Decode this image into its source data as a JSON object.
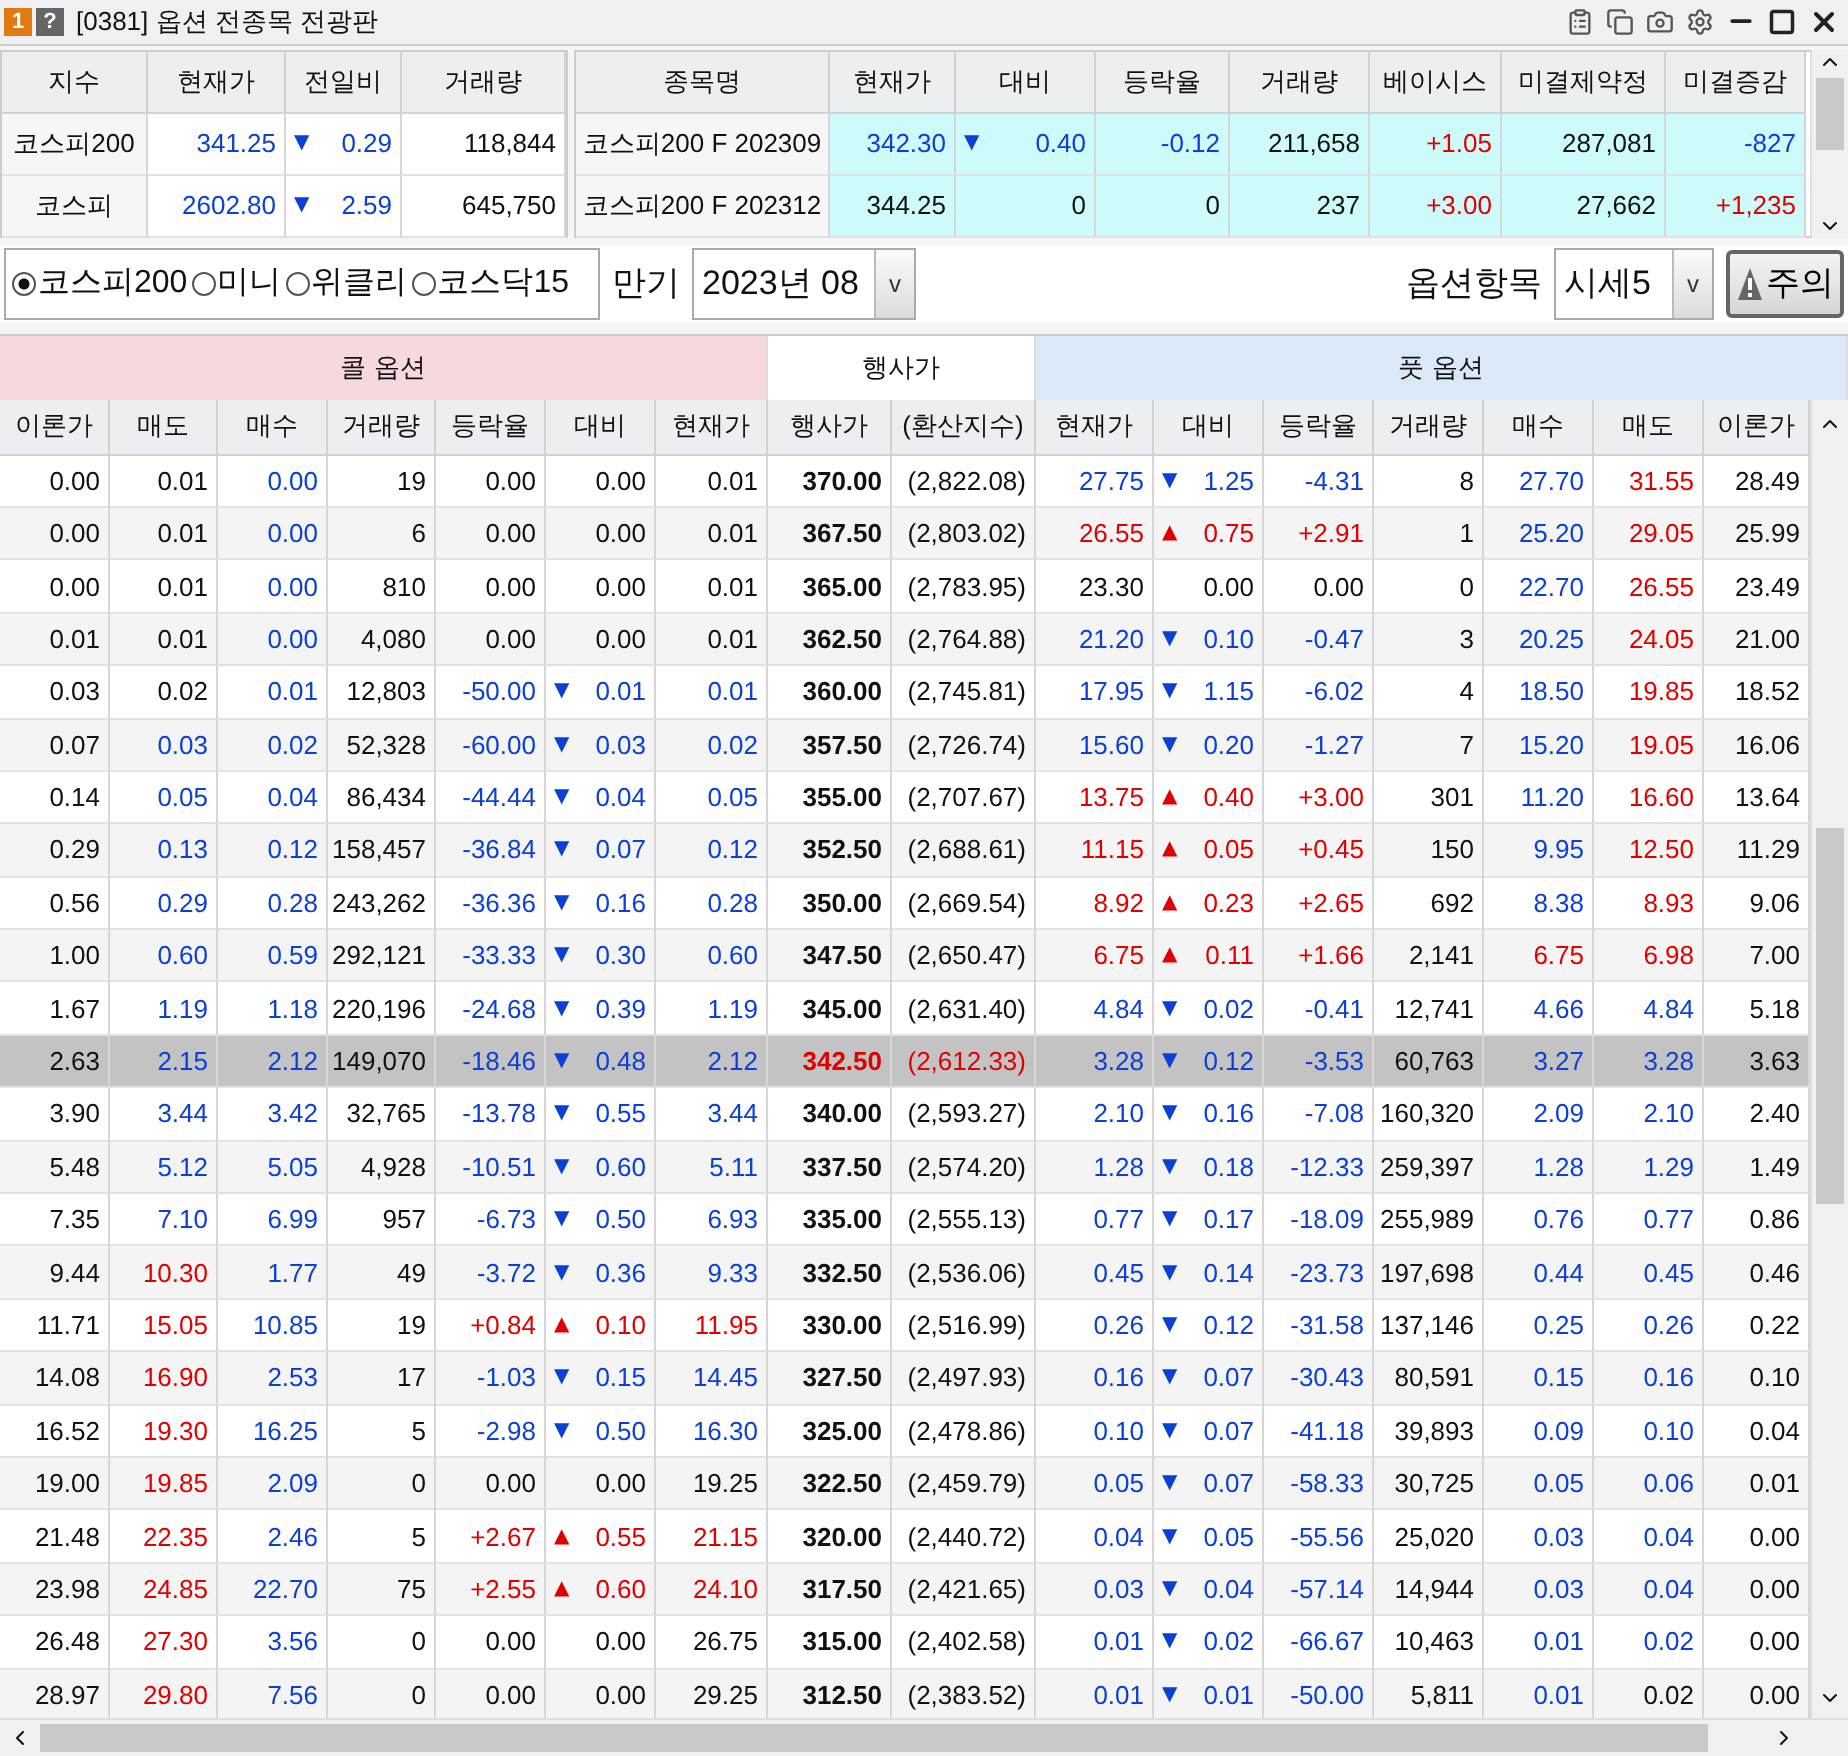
{
  "window": {
    "badges": [
      "1",
      "?"
    ],
    "title": "[0381] 옵션 전종목 전광판"
  },
  "index_table": {
    "columns": [
      "지수",
      "현재가",
      "전일비",
      "거래량"
    ],
    "rows": [
      {
        "cells": [
          {
            "text": "코스피200",
            "color": "#111111"
          },
          {
            "text": "341.25",
            "color": "#0b3fd6"
          },
          {
            "text": "0.29",
            "color": "#0b3fd6",
            "sign": "▼"
          },
          {
            "text": "118,844",
            "color": "#111111"
          }
        ]
      },
      {
        "cells": [
          {
            "text": "코스피",
            "color": "#111111"
          },
          {
            "text": "2602.80",
            "color": "#0b3fd6"
          },
          {
            "text": "2.59",
            "color": "#0b3fd6",
            "sign": "▼"
          },
          {
            "text": "645,750",
            "color": "#111111"
          }
        ]
      }
    ]
  },
  "futures_table": {
    "columns": [
      "종목명",
      "현재가",
      "대비",
      "등락율",
      "거래량",
      "베이시스",
      "미결제약정",
      "미결증감"
    ],
    "rows": [
      {
        "cells": [
          {
            "text": "코스피200 F 202309",
            "color": "#111111"
          },
          {
            "text": "342.30",
            "color": "#0b3fd6"
          },
          {
            "text": "0.40",
            "color": "#0b3fd6",
            "sign": "▼"
          },
          {
            "text": "-0.12",
            "color": "#0b3fd6"
          },
          {
            "text": "211,658",
            "color": "#111111"
          },
          {
            "text": "+1.05",
            "color": "#e00000"
          },
          {
            "text": "287,081",
            "color": "#111111"
          },
          {
            "text": "-827",
            "color": "#0b3fd6"
          }
        ]
      },
      {
        "cells": [
          {
            "text": "코스피200 F 202312",
            "color": "#111111"
          },
          {
            "text": "344.25",
            "color": "#111111"
          },
          {
            "text": "0",
            "color": "#111111"
          },
          {
            "text": "0",
            "color": "#111111"
          },
          {
            "text": "237",
            "color": "#111111"
          },
          {
            "text": "+3.00",
            "color": "#e00000"
          },
          {
            "text": "27,662",
            "color": "#111111"
          },
          {
            "text": "+1,235",
            "color": "#e00000"
          }
        ]
      }
    ]
  },
  "market_options": [
    {
      "label": "코스피200",
      "selected": true
    },
    {
      "label": "미니",
      "selected": false
    },
    {
      "label": "위클리",
      "selected": false
    },
    {
      "label": "코스닥15",
      "selected": false
    }
  ],
  "expiry": {
    "label": "만기",
    "value": "2023년 08",
    "button": "v"
  },
  "option_items": {
    "label": "옵션항목",
    "value": "시세5",
    "button": "v"
  },
  "warning_button": "주의",
  "board": {
    "call_title": "콜 옵션",
    "strike_title": "행사가",
    "put_title": "풋 옵션",
    "columns": [
      "이론가",
      "매도",
      "매수",
      "거래량",
      "등락율",
      "대비",
      "현재가",
      "행사가",
      "(환산지수)",
      "현재가",
      "대비",
      "등락율",
      "거래량",
      "매수",
      "매도",
      "이론가"
    ],
    "rows": [
      {
        "selected": false,
        "call": [
          {
            "text": "0.00",
            "color": "#111111"
          },
          {
            "text": "0.01",
            "color": "#111111"
          },
          {
            "text": "0.00",
            "color": "#0b3fd6"
          },
          {
            "text": "19",
            "color": "#111111"
          },
          {
            "text": "0.00",
            "color": "#111111"
          },
          {
            "text": "0.00",
            "color": "#111111"
          },
          {
            "text": "0.01",
            "color": "#111111"
          }
        ],
        "strike": {
          "text": "370.00",
          "color": "#111111"
        },
        "index": {
          "text": "(2,822.08)",
          "color": "#111111"
        },
        "put": [
          {
            "text": "27.75",
            "color": "#0b3fd6"
          },
          {
            "text": "1.25",
            "color": "#0b3fd6",
            "sign": "▼"
          },
          {
            "text": "-4.31",
            "color": "#0b3fd6"
          },
          {
            "text": "8",
            "color": "#111111"
          },
          {
            "text": "27.70",
            "color": "#0b3fd6"
          },
          {
            "text": "31.55",
            "color": "#e00000"
          },
          {
            "text": "28.49",
            "color": "#111111"
          }
        ]
      },
      {
        "selected": false,
        "call": [
          {
            "text": "0.00",
            "color": "#111111"
          },
          {
            "text": "0.01",
            "color": "#111111"
          },
          {
            "text": "0.00",
            "color": "#0b3fd6"
          },
          {
            "text": "6",
            "color": "#111111"
          },
          {
            "text": "0.00",
            "color": "#111111"
          },
          {
            "text": "0.00",
            "color": "#111111"
          },
          {
            "text": "0.01",
            "color": "#111111"
          }
        ],
        "strike": {
          "text": "367.50",
          "color": "#111111"
        },
        "index": {
          "text": "(2,803.02)",
          "color": "#111111"
        },
        "put": [
          {
            "text": "26.55",
            "color": "#e00000"
          },
          {
            "text": "0.75",
            "color": "#e00000",
            "sign": "▲"
          },
          {
            "text": "+2.91",
            "color": "#e00000"
          },
          {
            "text": "1",
            "color": "#111111"
          },
          {
            "text": "25.20",
            "color": "#0b3fd6"
          },
          {
            "text": "29.05",
            "color": "#e00000"
          },
          {
            "text": "25.99",
            "color": "#111111"
          }
        ]
      },
      {
        "selected": false,
        "call": [
          {
            "text": "0.00",
            "color": "#111111"
          },
          {
            "text": "0.01",
            "color": "#111111"
          },
          {
            "text": "0.00",
            "color": "#0b3fd6"
          },
          {
            "text": "810",
            "color": "#111111"
          },
          {
            "text": "0.00",
            "color": "#111111"
          },
          {
            "text": "0.00",
            "color": "#111111"
          },
          {
            "text": "0.01",
            "color": "#111111"
          }
        ],
        "strike": {
          "text": "365.00",
          "color": "#111111"
        },
        "index": {
          "text": "(2,783.95)",
          "color": "#111111"
        },
        "put": [
          {
            "text": "23.30",
            "color": "#111111"
          },
          {
            "text": "0.00",
            "color": "#111111"
          },
          {
            "text": "0.00",
            "color": "#111111"
          },
          {
            "text": "0",
            "color": "#111111"
          },
          {
            "text": "22.70",
            "color": "#0b3fd6"
          },
          {
            "text": "26.55",
            "color": "#e00000"
          },
          {
            "text": "23.49",
            "color": "#111111"
          }
        ]
      },
      {
        "selected": false,
        "call": [
          {
            "text": "0.01",
            "color": "#111111"
          },
          {
            "text": "0.01",
            "color": "#111111"
          },
          {
            "text": "0.00",
            "color": "#0b3fd6"
          },
          {
            "text": "4,080",
            "color": "#111111"
          },
          {
            "text": "0.00",
            "color": "#111111"
          },
          {
            "text": "0.00",
            "color": "#111111"
          },
          {
            "text": "0.01",
            "color": "#111111"
          }
        ],
        "strike": {
          "text": "362.50",
          "color": "#111111"
        },
        "index": {
          "text": "(2,764.88)",
          "color": "#111111"
        },
        "put": [
          {
            "text": "21.20",
            "color": "#0b3fd6"
          },
          {
            "text": "0.10",
            "color": "#0b3fd6",
            "sign": "▼"
          },
          {
            "text": "-0.47",
            "color": "#0b3fd6"
          },
          {
            "text": "3",
            "color": "#111111"
          },
          {
            "text": "20.25",
            "color": "#0b3fd6"
          },
          {
            "text": "24.05",
            "color": "#e00000"
          },
          {
            "text": "21.00",
            "color": "#111111"
          }
        ]
      },
      {
        "selected": false,
        "call": [
          {
            "text": "0.03",
            "color": "#111111"
          },
          {
            "text": "0.02",
            "color": "#111111"
          },
          {
            "text": "0.01",
            "color": "#0b3fd6"
          },
          {
            "text": "12,803",
            "color": "#111111"
          },
          {
            "text": "-50.00",
            "color": "#0b3fd6"
          },
          {
            "text": "0.01",
            "color": "#0b3fd6",
            "sign": "▼"
          },
          {
            "text": "0.01",
            "color": "#0b3fd6"
          }
        ],
        "strike": {
          "text": "360.00",
          "color": "#111111"
        },
        "index": {
          "text": "(2,745.81)",
          "color": "#111111"
        },
        "put": [
          {
            "text": "17.95",
            "color": "#0b3fd6"
          },
          {
            "text": "1.15",
            "color": "#0b3fd6",
            "sign": "▼"
          },
          {
            "text": "-6.02",
            "color": "#0b3fd6"
          },
          {
            "text": "4",
            "color": "#111111"
          },
          {
            "text": "18.50",
            "color": "#0b3fd6"
          },
          {
            "text": "19.85",
            "color": "#e00000"
          },
          {
            "text": "18.52",
            "color": "#111111"
          }
        ]
      },
      {
        "selected": false,
        "call": [
          {
            "text": "0.07",
            "color": "#111111"
          },
          {
            "text": "0.03",
            "color": "#0b3fd6"
          },
          {
            "text": "0.02",
            "color": "#0b3fd6"
          },
          {
            "text": "52,328",
            "color": "#111111"
          },
          {
            "text": "-60.00",
            "color": "#0b3fd6"
          },
          {
            "text": "0.03",
            "color": "#0b3fd6",
            "sign": "▼"
          },
          {
            "text": "0.02",
            "color": "#0b3fd6"
          }
        ],
        "strike": {
          "text": "357.50",
          "color": "#111111"
        },
        "index": {
          "text": "(2,726.74)",
          "color": "#111111"
        },
        "put": [
          {
            "text": "15.60",
            "color": "#0b3fd6"
          },
          {
            "text": "0.20",
            "color": "#0b3fd6",
            "sign": "▼"
          },
          {
            "text": "-1.27",
            "color": "#0b3fd6"
          },
          {
            "text": "7",
            "color": "#111111"
          },
          {
            "text": "15.20",
            "color": "#0b3fd6"
          },
          {
            "text": "19.05",
            "color": "#e00000"
          },
          {
            "text": "16.06",
            "color": "#111111"
          }
        ]
      },
      {
        "selected": false,
        "call": [
          {
            "text": "0.14",
            "color": "#111111"
          },
          {
            "text": "0.05",
            "color": "#0b3fd6"
          },
          {
            "text": "0.04",
            "color": "#0b3fd6"
          },
          {
            "text": "86,434",
            "color": "#111111"
          },
          {
            "text": "-44.44",
            "color": "#0b3fd6"
          },
          {
            "text": "0.04",
            "color": "#0b3fd6",
            "sign": "▼"
          },
          {
            "text": "0.05",
            "color": "#0b3fd6"
          }
        ],
        "strike": {
          "text": "355.00",
          "color": "#111111"
        },
        "index": {
          "text": "(2,707.67)",
          "color": "#111111"
        },
        "put": [
          {
            "text": "13.75",
            "color": "#e00000"
          },
          {
            "text": "0.40",
            "color": "#e00000",
            "sign": "▲"
          },
          {
            "text": "+3.00",
            "color": "#e00000"
          },
          {
            "text": "301",
            "color": "#111111"
          },
          {
            "text": "11.20",
            "color": "#0b3fd6"
          },
          {
            "text": "16.60",
            "color": "#e00000"
          },
          {
            "text": "13.64",
            "color": "#111111"
          }
        ]
      },
      {
        "selected": false,
        "call": [
          {
            "text": "0.29",
            "color": "#111111"
          },
          {
            "text": "0.13",
            "color": "#0b3fd6"
          },
          {
            "text": "0.12",
            "color": "#0b3fd6"
          },
          {
            "text": "158,457",
            "color": "#111111"
          },
          {
            "text": "-36.84",
            "color": "#0b3fd6"
          },
          {
            "text": "0.07",
            "color": "#0b3fd6",
            "sign": "▼"
          },
          {
            "text": "0.12",
            "color": "#0b3fd6"
          }
        ],
        "strike": {
          "text": "352.50",
          "color": "#111111"
        },
        "index": {
          "text": "(2,688.61)",
          "color": "#111111"
        },
        "put": [
          {
            "text": "11.15",
            "color": "#e00000"
          },
          {
            "text": "0.05",
            "color": "#e00000",
            "sign": "▲"
          },
          {
            "text": "+0.45",
            "color": "#e00000"
          },
          {
            "text": "150",
            "color": "#111111"
          },
          {
            "text": "9.95",
            "color": "#0b3fd6"
          },
          {
            "text": "12.50",
            "color": "#e00000"
          },
          {
            "text": "11.29",
            "color": "#111111"
          }
        ]
      },
      {
        "selected": false,
        "call": [
          {
            "text": "0.56",
            "color": "#111111"
          },
          {
            "text": "0.29",
            "color": "#0b3fd6"
          },
          {
            "text": "0.28",
            "color": "#0b3fd6"
          },
          {
            "text": "243,262",
            "color": "#111111"
          },
          {
            "text": "-36.36",
            "color": "#0b3fd6"
          },
          {
            "text": "0.16",
            "color": "#0b3fd6",
            "sign": "▼"
          },
          {
            "text": "0.28",
            "color": "#0b3fd6"
          }
        ],
        "strike": {
          "text": "350.00",
          "color": "#111111"
        },
        "index": {
          "text": "(2,669.54)",
          "color": "#111111"
        },
        "put": [
          {
            "text": "8.92",
            "color": "#e00000"
          },
          {
            "text": "0.23",
            "color": "#e00000",
            "sign": "▲"
          },
          {
            "text": "+2.65",
            "color": "#e00000"
          },
          {
            "text": "692",
            "color": "#111111"
          },
          {
            "text": "8.38",
            "color": "#0b3fd6"
          },
          {
            "text": "8.93",
            "color": "#e00000"
          },
          {
            "text": "9.06",
            "color": "#111111"
          }
        ]
      },
      {
        "selected": false,
        "call": [
          {
            "text": "1.00",
            "color": "#111111"
          },
          {
            "text": "0.60",
            "color": "#0b3fd6"
          },
          {
            "text": "0.59",
            "color": "#0b3fd6"
          },
          {
            "text": "292,121",
            "color": "#111111"
          },
          {
            "text": "-33.33",
            "color": "#0b3fd6"
          },
          {
            "text": "0.30",
            "color": "#0b3fd6",
            "sign": "▼"
          },
          {
            "text": "0.60",
            "color": "#0b3fd6"
          }
        ],
        "strike": {
          "text": "347.50",
          "color": "#111111"
        },
        "index": {
          "text": "(2,650.47)",
          "color": "#111111"
        },
        "put": [
          {
            "text": "6.75",
            "color": "#e00000"
          },
          {
            "text": "0.11",
            "color": "#e00000",
            "sign": "▲"
          },
          {
            "text": "+1.66",
            "color": "#e00000"
          },
          {
            "text": "2,141",
            "color": "#111111"
          },
          {
            "text": "6.75",
            "color": "#e00000"
          },
          {
            "text": "6.98",
            "color": "#e00000"
          },
          {
            "text": "7.00",
            "color": "#111111"
          }
        ]
      },
      {
        "selected": false,
        "call": [
          {
            "text": "1.67",
            "color": "#111111"
          },
          {
            "text": "1.19",
            "color": "#0b3fd6"
          },
          {
            "text": "1.18",
            "color": "#0b3fd6"
          },
          {
            "text": "220,196",
            "color": "#111111"
          },
          {
            "text": "-24.68",
            "color": "#0b3fd6"
          },
          {
            "text": "0.39",
            "color": "#0b3fd6",
            "sign": "▼"
          },
          {
            "text": "1.19",
            "color": "#0b3fd6"
          }
        ],
        "strike": {
          "text": "345.00",
          "color": "#111111"
        },
        "index": {
          "text": "(2,631.40)",
          "color": "#111111"
        },
        "put": [
          {
            "text": "4.84",
            "color": "#0b3fd6"
          },
          {
            "text": "0.02",
            "color": "#0b3fd6",
            "sign": "▼"
          },
          {
            "text": "-0.41",
            "color": "#0b3fd6"
          },
          {
            "text": "12,741",
            "color": "#111111"
          },
          {
            "text": "4.66",
            "color": "#0b3fd6"
          },
          {
            "text": "4.84",
            "color": "#0b3fd6"
          },
          {
            "text": "5.18",
            "color": "#111111"
          }
        ]
      },
      {
        "selected": true,
        "call": [
          {
            "text": "2.63",
            "color": "#111111"
          },
          {
            "text": "2.15",
            "color": "#0b3fd6"
          },
          {
            "text": "2.12",
            "color": "#0b3fd6"
          },
          {
            "text": "149,070",
            "color": "#111111"
          },
          {
            "text": "-18.46",
            "color": "#0b3fd6"
          },
          {
            "text": "0.48",
            "color": "#0b3fd6",
            "sign": "▼"
          },
          {
            "text": "2.12",
            "color": "#0b3fd6"
          }
        ],
        "strike": {
          "text": "342.50",
          "color": "#e00000"
        },
        "index": {
          "text": "(2,612.33)",
          "color": "#e00000"
        },
        "put": [
          {
            "text": "3.28",
            "color": "#0b3fd6"
          },
          {
            "text": "0.12",
            "color": "#0b3fd6",
            "sign": "▼"
          },
          {
            "text": "-3.53",
            "color": "#0b3fd6"
          },
          {
            "text": "60,763",
            "color": "#111111"
          },
          {
            "text": "3.27",
            "color": "#0b3fd6"
          },
          {
            "text": "3.28",
            "color": "#0b3fd6"
          },
          {
            "text": "3.63",
            "color": "#111111"
          }
        ]
      },
      {
        "selected": false,
        "call": [
          {
            "text": "3.90",
            "color": "#111111"
          },
          {
            "text": "3.44",
            "color": "#0b3fd6"
          },
          {
            "text": "3.42",
            "color": "#0b3fd6"
          },
          {
            "text": "32,765",
            "color": "#111111"
          },
          {
            "text": "-13.78",
            "color": "#0b3fd6"
          },
          {
            "text": "0.55",
            "color": "#0b3fd6",
            "sign": "▼"
          },
          {
            "text": "3.44",
            "color": "#0b3fd6"
          }
        ],
        "strike": {
          "text": "340.00",
          "color": "#111111"
        },
        "index": {
          "text": "(2,593.27)",
          "color": "#111111"
        },
        "put": [
          {
            "text": "2.10",
            "color": "#0b3fd6"
          },
          {
            "text": "0.16",
            "color": "#0b3fd6",
            "sign": "▼"
          },
          {
            "text": "-7.08",
            "color": "#0b3fd6"
          },
          {
            "text": "160,320",
            "color": "#111111"
          },
          {
            "text": "2.09",
            "color": "#0b3fd6"
          },
          {
            "text": "2.10",
            "color": "#0b3fd6"
          },
          {
            "text": "2.40",
            "color": "#111111"
          }
        ]
      },
      {
        "selected": false,
        "call": [
          {
            "text": "5.48",
            "color": "#111111"
          },
          {
            "text": "5.12",
            "color": "#0b3fd6"
          },
          {
            "text": "5.05",
            "color": "#0b3fd6"
          },
          {
            "text": "4,928",
            "color": "#111111"
          },
          {
            "text": "-10.51",
            "color": "#0b3fd6"
          },
          {
            "text": "0.60",
            "color": "#0b3fd6",
            "sign": "▼"
          },
          {
            "text": "5.11",
            "color": "#0b3fd6"
          }
        ],
        "strike": {
          "text": "337.50",
          "color": "#111111"
        },
        "index": {
          "text": "(2,574.20)",
          "color": "#111111"
        },
        "put": [
          {
            "text": "1.28",
            "color": "#0b3fd6"
          },
          {
            "text": "0.18",
            "color": "#0b3fd6",
            "sign": "▼"
          },
          {
            "text": "-12.33",
            "color": "#0b3fd6"
          },
          {
            "text": "259,397",
            "color": "#111111"
          },
          {
            "text": "1.28",
            "color": "#0b3fd6"
          },
          {
            "text": "1.29",
            "color": "#0b3fd6"
          },
          {
            "text": "1.49",
            "color": "#111111"
          }
        ]
      },
      {
        "selected": false,
        "call": [
          {
            "text": "7.35",
            "color": "#111111"
          },
          {
            "text": "7.10",
            "color": "#0b3fd6"
          },
          {
            "text": "6.99",
            "color": "#0b3fd6"
          },
          {
            "text": "957",
            "color": "#111111"
          },
          {
            "text": "-6.73",
            "color": "#0b3fd6"
          },
          {
            "text": "0.50",
            "color": "#0b3fd6",
            "sign": "▼"
          },
          {
            "text": "6.93",
            "color": "#0b3fd6"
          }
        ],
        "strike": {
          "text": "335.00",
          "color": "#111111"
        },
        "index": {
          "text": "(2,555.13)",
          "color": "#111111"
        },
        "put": [
          {
            "text": "0.77",
            "color": "#0b3fd6"
          },
          {
            "text": "0.17",
            "color": "#0b3fd6",
            "sign": "▼"
          },
          {
            "text": "-18.09",
            "color": "#0b3fd6"
          },
          {
            "text": "255,989",
            "color": "#111111"
          },
          {
            "text": "0.76",
            "color": "#0b3fd6"
          },
          {
            "text": "0.77",
            "color": "#0b3fd6"
          },
          {
            "text": "0.86",
            "color": "#111111"
          }
        ]
      },
      {
        "selected": false,
        "call": [
          {
            "text": "9.44",
            "color": "#111111"
          },
          {
            "text": "10.30",
            "color": "#e00000"
          },
          {
            "text": "1.77",
            "color": "#0b3fd6"
          },
          {
            "text": "49",
            "color": "#111111"
          },
          {
            "text": "-3.72",
            "color": "#0b3fd6"
          },
          {
            "text": "0.36",
            "color": "#0b3fd6",
            "sign": "▼"
          },
          {
            "text": "9.33",
            "color": "#0b3fd6"
          }
        ],
        "strike": {
          "text": "332.50",
          "color": "#111111"
        },
        "index": {
          "text": "(2,536.06)",
          "color": "#111111"
        },
        "put": [
          {
            "text": "0.45",
            "color": "#0b3fd6"
          },
          {
            "text": "0.14",
            "color": "#0b3fd6",
            "sign": "▼"
          },
          {
            "text": "-23.73",
            "color": "#0b3fd6"
          },
          {
            "text": "197,698",
            "color": "#111111"
          },
          {
            "text": "0.44",
            "color": "#0b3fd6"
          },
          {
            "text": "0.45",
            "color": "#0b3fd6"
          },
          {
            "text": "0.46",
            "color": "#111111"
          }
        ]
      },
      {
        "selected": false,
        "call": [
          {
            "text": "11.71",
            "color": "#111111"
          },
          {
            "text": "15.05",
            "color": "#e00000"
          },
          {
            "text": "10.85",
            "color": "#0b3fd6"
          },
          {
            "text": "19",
            "color": "#111111"
          },
          {
            "text": "+0.84",
            "color": "#e00000"
          },
          {
            "text": "0.10",
            "color": "#e00000",
            "sign": "▲"
          },
          {
            "text": "11.95",
            "color": "#e00000"
          }
        ],
        "strike": {
          "text": "330.00",
          "color": "#111111"
        },
        "index": {
          "text": "(2,516.99)",
          "color": "#111111"
        },
        "put": [
          {
            "text": "0.26",
            "color": "#0b3fd6"
          },
          {
            "text": "0.12",
            "color": "#0b3fd6",
            "sign": "▼"
          },
          {
            "text": "-31.58",
            "color": "#0b3fd6"
          },
          {
            "text": "137,146",
            "color": "#111111"
          },
          {
            "text": "0.25",
            "color": "#0b3fd6"
          },
          {
            "text": "0.26",
            "color": "#0b3fd6"
          },
          {
            "text": "0.22",
            "color": "#111111"
          }
        ]
      },
      {
        "selected": false,
        "call": [
          {
            "text": "14.08",
            "color": "#111111"
          },
          {
            "text": "16.90",
            "color": "#e00000"
          },
          {
            "text": "2.53",
            "color": "#0b3fd6"
          },
          {
            "text": "17",
            "color": "#111111"
          },
          {
            "text": "-1.03",
            "color": "#0b3fd6"
          },
          {
            "text": "0.15",
            "color": "#0b3fd6",
            "sign": "▼"
          },
          {
            "text": "14.45",
            "color": "#0b3fd6"
          }
        ],
        "strike": {
          "text": "327.50",
          "color": "#111111"
        },
        "index": {
          "text": "(2,497.93)",
          "color": "#111111"
        },
        "put": [
          {
            "text": "0.16",
            "color": "#0b3fd6"
          },
          {
            "text": "0.07",
            "color": "#0b3fd6",
            "sign": "▼"
          },
          {
            "text": "-30.43",
            "color": "#0b3fd6"
          },
          {
            "text": "80,591",
            "color": "#111111"
          },
          {
            "text": "0.15",
            "color": "#0b3fd6"
          },
          {
            "text": "0.16",
            "color": "#0b3fd6"
          },
          {
            "text": "0.10",
            "color": "#111111"
          }
        ]
      },
      {
        "selected": false,
        "call": [
          {
            "text": "16.52",
            "color": "#111111"
          },
          {
            "text": "19.30",
            "color": "#e00000"
          },
          {
            "text": "16.25",
            "color": "#0b3fd6"
          },
          {
            "text": "5",
            "color": "#111111"
          },
          {
            "text": "-2.98",
            "color": "#0b3fd6"
          },
          {
            "text": "0.50",
            "color": "#0b3fd6",
            "sign": "▼"
          },
          {
            "text": "16.30",
            "color": "#0b3fd6"
          }
        ],
        "strike": {
          "text": "325.00",
          "color": "#111111"
        },
        "index": {
          "text": "(2,478.86)",
          "color": "#111111"
        },
        "put": [
          {
            "text": "0.10",
            "color": "#0b3fd6"
          },
          {
            "text": "0.07",
            "color": "#0b3fd6",
            "sign": "▼"
          },
          {
            "text": "-41.18",
            "color": "#0b3fd6"
          },
          {
            "text": "39,893",
            "color": "#111111"
          },
          {
            "text": "0.09",
            "color": "#0b3fd6"
          },
          {
            "text": "0.10",
            "color": "#0b3fd6"
          },
          {
            "text": "0.04",
            "color": "#111111"
          }
        ]
      },
      {
        "selected": false,
        "call": [
          {
            "text": "19.00",
            "color": "#111111"
          },
          {
            "text": "19.85",
            "color": "#e00000"
          },
          {
            "text": "2.09",
            "color": "#0b3fd6"
          },
          {
            "text": "0",
            "color": "#111111"
          },
          {
            "text": "0.00",
            "color": "#111111"
          },
          {
            "text": "0.00",
            "color": "#111111"
          },
          {
            "text": "19.25",
            "color": "#111111"
          }
        ],
        "strike": {
          "text": "322.50",
          "color": "#111111"
        },
        "index": {
          "text": "(2,459.79)",
          "color": "#111111"
        },
        "put": [
          {
            "text": "0.05",
            "color": "#0b3fd6"
          },
          {
            "text": "0.07",
            "color": "#0b3fd6",
            "sign": "▼"
          },
          {
            "text": "-58.33",
            "color": "#0b3fd6"
          },
          {
            "text": "30,725",
            "color": "#111111"
          },
          {
            "text": "0.05",
            "color": "#0b3fd6"
          },
          {
            "text": "0.06",
            "color": "#0b3fd6"
          },
          {
            "text": "0.01",
            "color": "#111111"
          }
        ]
      },
      {
        "selected": false,
        "call": [
          {
            "text": "21.48",
            "color": "#111111"
          },
          {
            "text": "22.35",
            "color": "#e00000"
          },
          {
            "text": "2.46",
            "color": "#0b3fd6"
          },
          {
            "text": "5",
            "color": "#111111"
          },
          {
            "text": "+2.67",
            "color": "#e00000"
          },
          {
            "text": "0.55",
            "color": "#e00000",
            "sign": "▲"
          },
          {
            "text": "21.15",
            "color": "#e00000"
          }
        ],
        "strike": {
          "text": "320.00",
          "color": "#111111"
        },
        "index": {
          "text": "(2,440.72)",
          "color": "#111111"
        },
        "put": [
          {
            "text": "0.04",
            "color": "#0b3fd6"
          },
          {
            "text": "0.05",
            "color": "#0b3fd6",
            "sign": "▼"
          },
          {
            "text": "-55.56",
            "color": "#0b3fd6"
          },
          {
            "text": "25,020",
            "color": "#111111"
          },
          {
            "text": "0.03",
            "color": "#0b3fd6"
          },
          {
            "text": "0.04",
            "color": "#0b3fd6"
          },
          {
            "text": "0.00",
            "color": "#111111"
          }
        ]
      },
      {
        "selected": false,
        "call": [
          {
            "text": "23.98",
            "color": "#111111"
          },
          {
            "text": "24.85",
            "color": "#e00000"
          },
          {
            "text": "22.70",
            "color": "#0b3fd6"
          },
          {
            "text": "75",
            "color": "#111111"
          },
          {
            "text": "+2.55",
            "color": "#e00000"
          },
          {
            "text": "0.60",
            "color": "#e00000",
            "sign": "▲"
          },
          {
            "text": "24.10",
            "color": "#e00000"
          }
        ],
        "strike": {
          "text": "317.50",
          "color": "#111111"
        },
        "index": {
          "text": "(2,421.65)",
          "color": "#111111"
        },
        "put": [
          {
            "text": "0.03",
            "color": "#0b3fd6"
          },
          {
            "text": "0.04",
            "color": "#0b3fd6",
            "sign": "▼"
          },
          {
            "text": "-57.14",
            "color": "#0b3fd6"
          },
          {
            "text": "14,944",
            "color": "#111111"
          },
          {
            "text": "0.03",
            "color": "#0b3fd6"
          },
          {
            "text": "0.04",
            "color": "#0b3fd6"
          },
          {
            "text": "0.00",
            "color": "#111111"
          }
        ]
      },
      {
        "selected": false,
        "call": [
          {
            "text": "26.48",
            "color": "#111111"
          },
          {
            "text": "27.30",
            "color": "#e00000"
          },
          {
            "text": "3.56",
            "color": "#0b3fd6"
          },
          {
            "text": "0",
            "color": "#111111"
          },
          {
            "text": "0.00",
            "color": "#111111"
          },
          {
            "text": "0.00",
            "color": "#111111"
          },
          {
            "text": "26.75",
            "color": "#111111"
          }
        ],
        "strike": {
          "text": "315.00",
          "color": "#111111"
        },
        "index": {
          "text": "(2,402.58)",
          "color": "#111111"
        },
        "put": [
          {
            "text": "0.01",
            "color": "#0b3fd6"
          },
          {
            "text": "0.02",
            "color": "#0b3fd6",
            "sign": "▼"
          },
          {
            "text": "-66.67",
            "color": "#0b3fd6"
          },
          {
            "text": "10,463",
            "color": "#111111"
          },
          {
            "text": "0.01",
            "color": "#0b3fd6"
          },
          {
            "text": "0.02",
            "color": "#0b3fd6"
          },
          {
            "text": "0.00",
            "color": "#111111"
          }
        ]
      },
      {
        "selected": false,
        "call": [
          {
            "text": "28.97",
            "color": "#111111"
          },
          {
            "text": "29.80",
            "color": "#e00000"
          },
          {
            "text": "7.56",
            "color": "#0b3fd6"
          },
          {
            "text": "0",
            "color": "#111111"
          },
          {
            "text": "0.00",
            "color": "#111111"
          },
          {
            "text": "0.00",
            "color": "#111111"
          },
          {
            "text": "29.25",
            "color": "#111111"
          }
        ],
        "strike": {
          "text": "312.50",
          "color": "#111111"
        },
        "index": {
          "text": "(2,383.52)",
          "color": "#111111"
        },
        "put": [
          {
            "text": "0.01",
            "color": "#0b3fd6"
          },
          {
            "text": "0.01",
            "color": "#0b3fd6",
            "sign": "▼"
          },
          {
            "text": "-50.00",
            "color": "#0b3fd6"
          },
          {
            "text": "5,811",
            "color": "#111111"
          },
          {
            "text": "0.01",
            "color": "#0b3fd6"
          },
          {
            "text": "0.02",
            "color": "#111111"
          },
          {
            "text": "0.00",
            "color": "#111111"
          }
        ]
      }
    ]
  }
}
